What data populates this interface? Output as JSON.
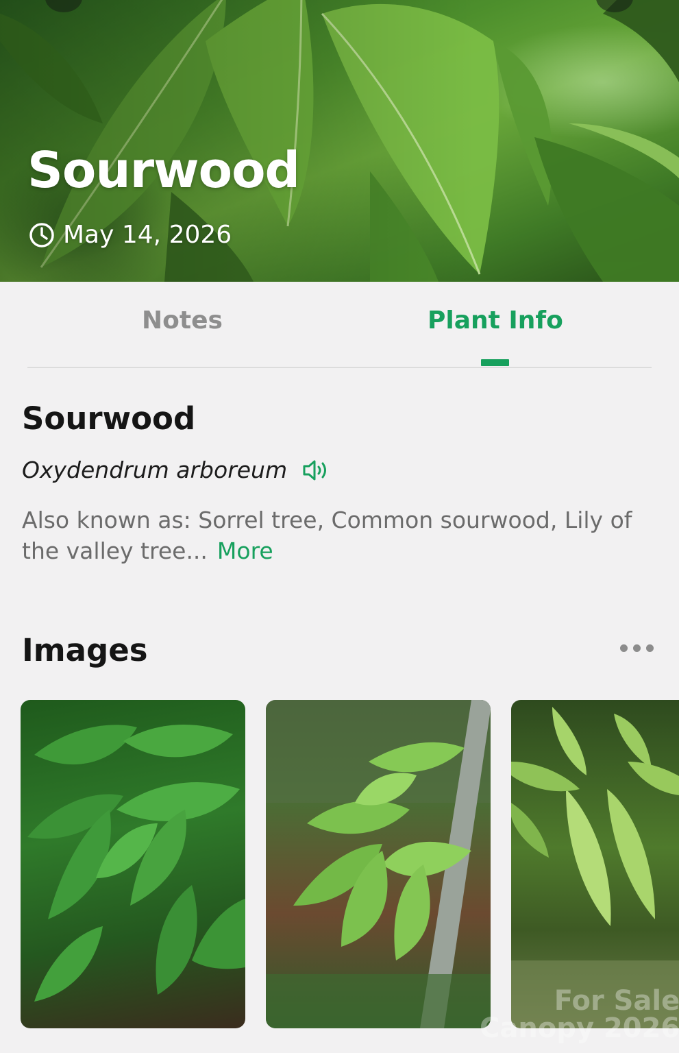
{
  "hero": {
    "title": "Sourwood",
    "date": "May 14, 2026"
  },
  "tabs": [
    {
      "label": "Notes",
      "active": false
    },
    {
      "label": "Plant Info",
      "active": true
    }
  ],
  "plant": {
    "common_name": "Sourwood",
    "scientific_name": "Oxydendrum arboreum",
    "also_known_as": "Also known as: Sorrel tree, Common sourwood, Lily of the valley tree...",
    "more_label": "More"
  },
  "images_section": {
    "title": "Images",
    "count_visible": 3
  },
  "watermark": {
    "line1": "For Sale",
    "line2": "Canopy 2026"
  },
  "colors": {
    "accent": "#17a05d",
    "background": "#f2f1f2",
    "inactive_tab": "#8e8e8e"
  },
  "icons": {
    "date": "clock-icon",
    "pronunciation": "speaker-icon",
    "menu": "more-dots-icon"
  }
}
